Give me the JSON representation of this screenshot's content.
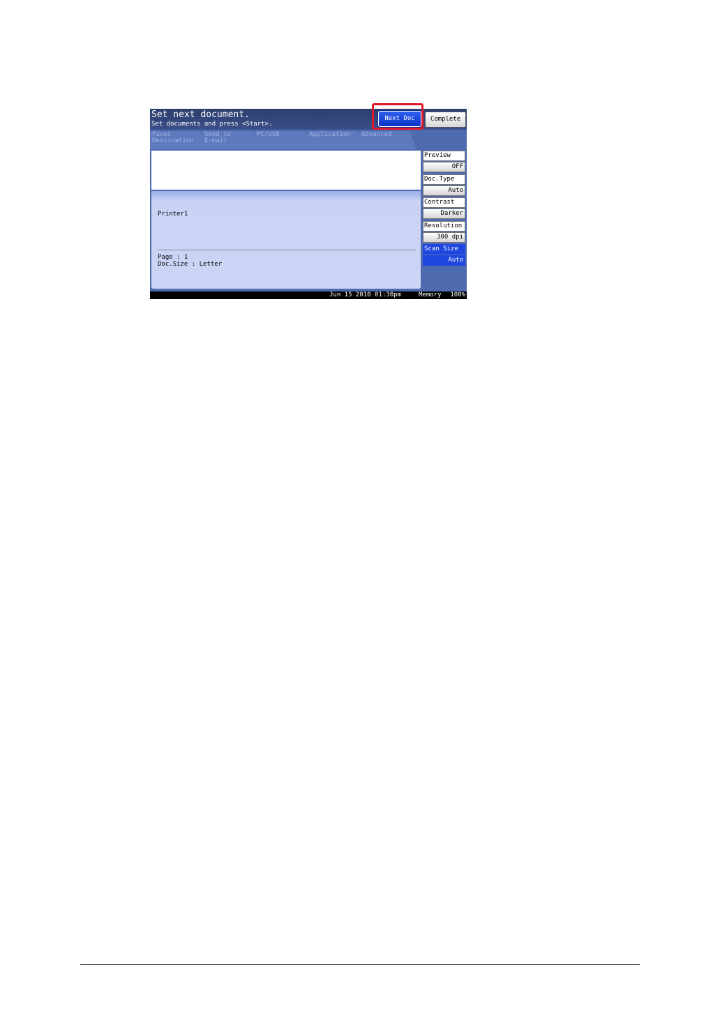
{
  "header": {
    "title": "Set next document.",
    "subtitle": "Set documents and press <Start>.",
    "next_doc_label": "Next Doc",
    "complete_label": "Complete"
  },
  "tabs": [
    {
      "label": "Faves\nDestination"
    },
    {
      "label": "Send to\nE-mail"
    },
    {
      "label": "PC/USB"
    },
    {
      "label": "Application"
    },
    {
      "label": "Advanced"
    }
  ],
  "panel": {
    "destination": "Printer1",
    "page_line": "Page : 1",
    "doc_size_line": "Doc.Size : Letter"
  },
  "side": {
    "preview_label": "Preview",
    "preview_value": "OFF",
    "doctype_label": "Doc.Type",
    "doctype_value": "Auto",
    "contrast_label": "Contrast",
    "contrast_value": "Darker",
    "resolution_label": "Resolution",
    "resolution_value": "300 dpi",
    "scansize_label": "Scan Size",
    "scansize_value": "Auto"
  },
  "status": {
    "datetime": "Jun 15 2010 01:30pm",
    "memory_label": "Memory",
    "memory_value": "100%"
  },
  "colors": {
    "highlight": "#e0182a",
    "active_button": "#1f47e0"
  }
}
